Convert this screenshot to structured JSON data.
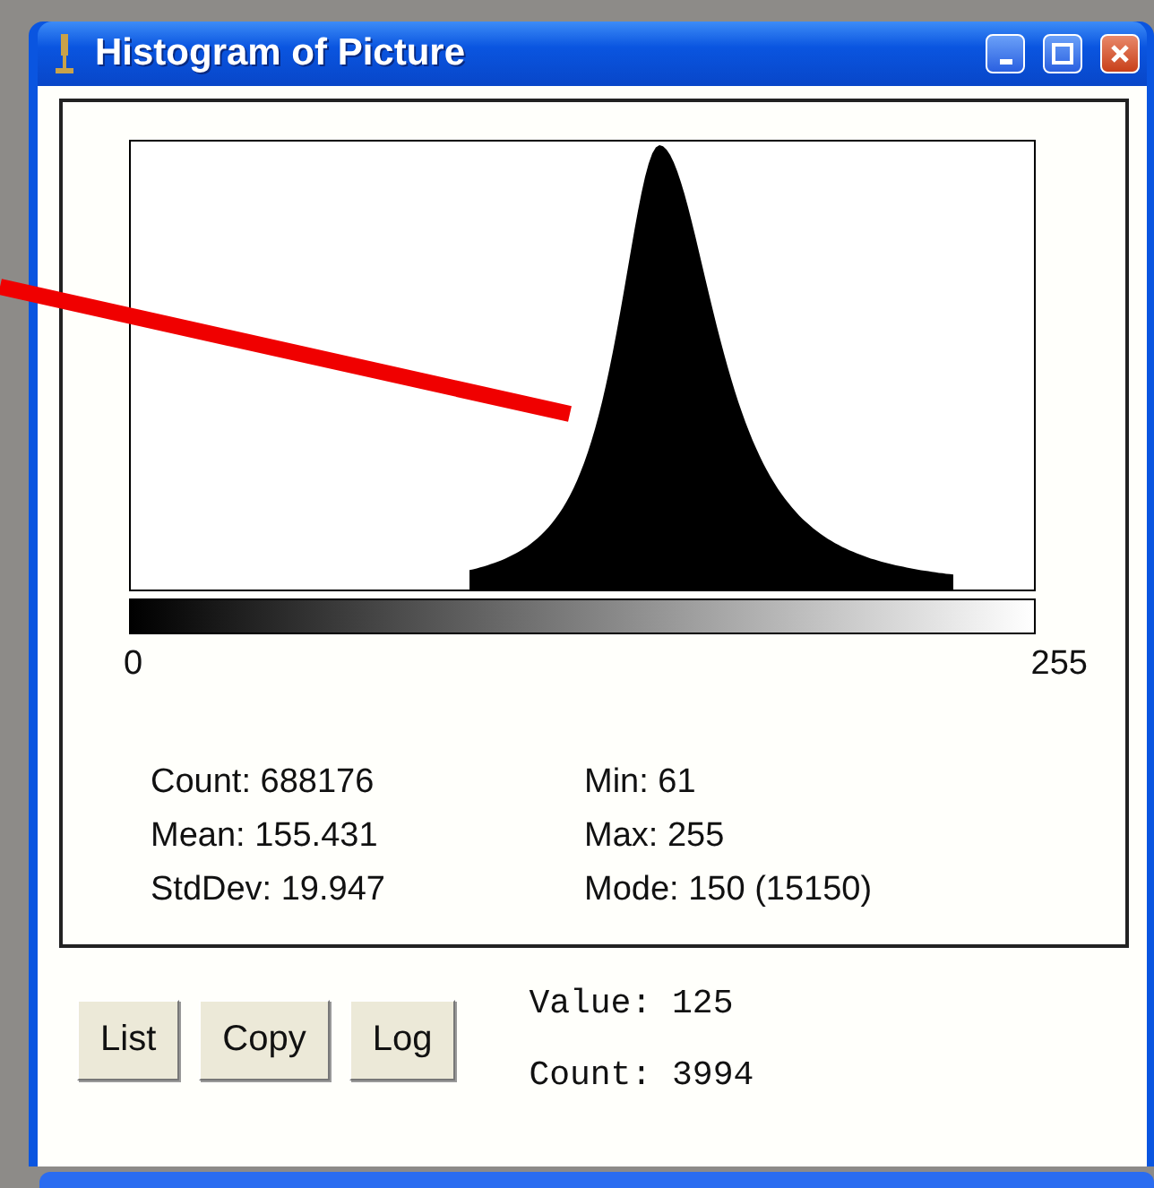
{
  "window": {
    "title": "Histogram of Picture"
  },
  "histogram": {
    "axis_min": "0",
    "axis_max": "255"
  },
  "stats": {
    "left": [
      "Count: 688176",
      "Mean: 155.431",
      "StdDev: 19.947"
    ],
    "right": [
      "Min: 61",
      "Max: 255",
      "Mode: 150 (15150)"
    ]
  },
  "buttons": [
    "List",
    "Copy",
    "Log"
  ],
  "readout": [
    "Value: 125",
    "Count: 3994"
  ]
}
